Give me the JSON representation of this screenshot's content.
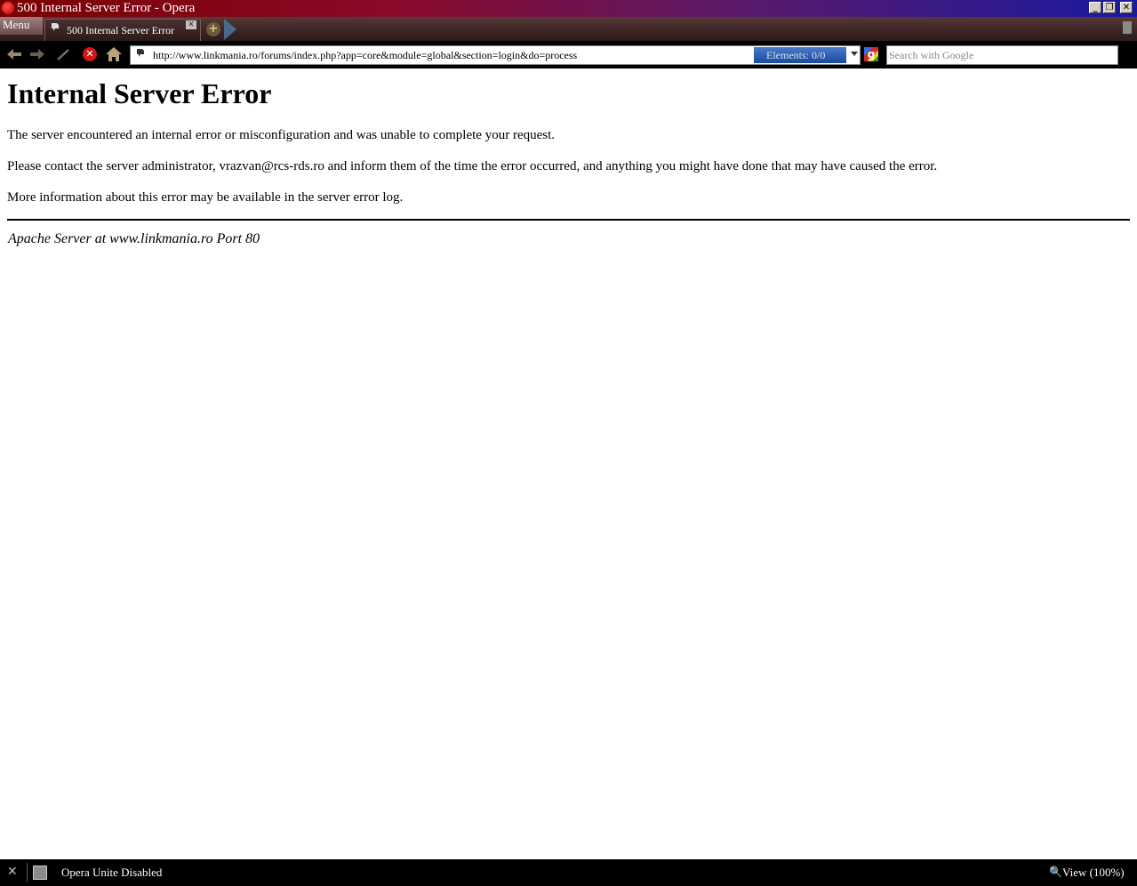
{
  "window": {
    "title": "500 Internal Server Error - Opera",
    "controls": {
      "minimize": "_",
      "restore": "❐",
      "close": "✕"
    }
  },
  "tabbar": {
    "menu_label": "Menu",
    "tabs": [
      {
        "label": "500 Internal Server Error",
        "active": true,
        "close": "✕"
      }
    ],
    "new_tab_glyph": "+"
  },
  "navbar": {
    "url": "http://www.linkmania.ro/forums/index.php?app=core&module=global&section=login&do=process",
    "elements_label": "Elements:   0/0",
    "search_placeholder": "Search with Google",
    "google_glyph": "g",
    "icons": {
      "back": "back-arrow-icon",
      "forward": "forward-arrow-icon",
      "rewind": "wand-icon",
      "stop": "stop-icon",
      "home": "home-icon"
    }
  },
  "page": {
    "heading": "Internal Server Error",
    "paragraphs": [
      "The server encountered an internal error or misconfiguration and was unable to complete your request.",
      "Please contact the server administrator, vrazvan@rcs-rds.ro and inform them of the time the error occurred, and anything you might have done that may have caused the error.",
      "More information about this error may be available in the server error log."
    ],
    "address": "Apache Server at www.linkmania.ro Port 80"
  },
  "statusbar": {
    "unite_status": "Opera Unite Disabled",
    "zoom_label": "View (100%)"
  },
  "colors": {
    "titlebar_start": "#7a0000",
    "titlebar_end": "#1a1aa0",
    "toolbar_bg": "#000000",
    "elements_badge": "#1a4a9a"
  }
}
